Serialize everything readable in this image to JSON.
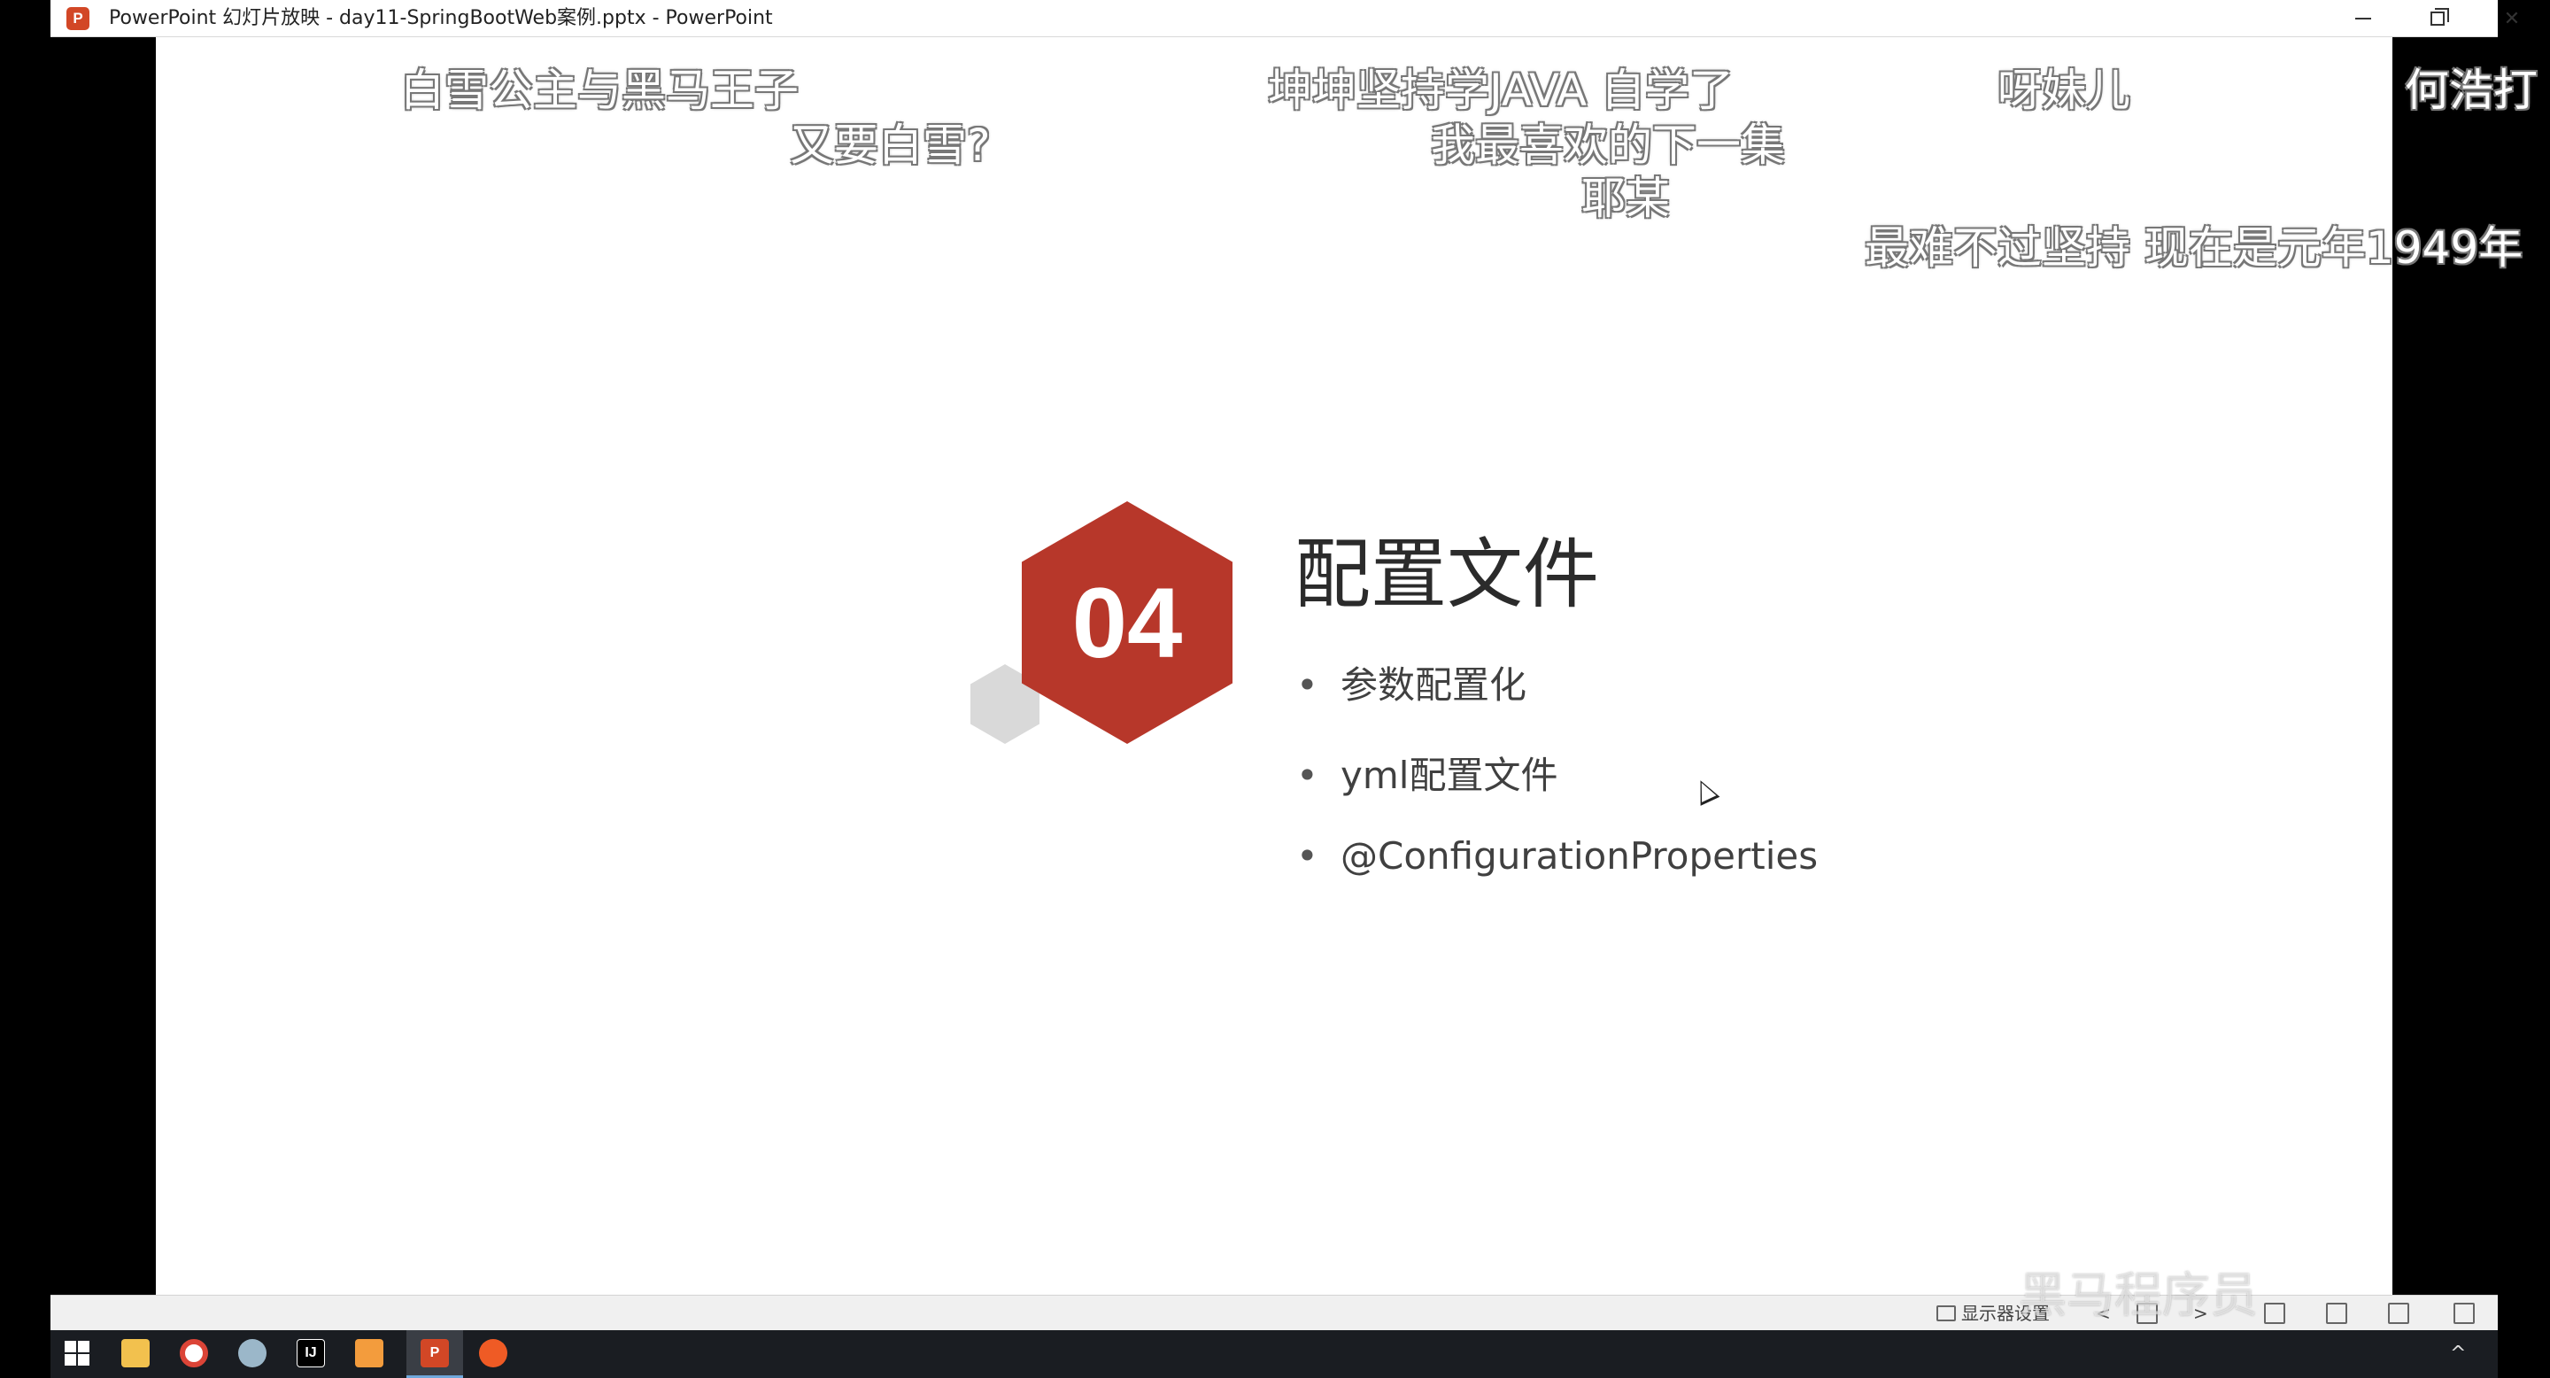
{
  "window": {
    "title": "PowerPoint 幻灯片放映  -  day11-SpringBootWeb案例.pptx - PowerPoint",
    "app_icon": "P",
    "controls": [
      "minimize",
      "restore",
      "close"
    ]
  },
  "danmaku": [
    "白雪公主与黑马王子",
    "又要白雪?",
    "坤坤坚持学JAVA  自学了",
    "我最喜欢的下一集",
    "耶某",
    "呀妹儿",
    "何浩打",
    "最难不过坚持 现在是元年1949年"
  ],
  "slide": {
    "section_number": "04",
    "title": "配置文件",
    "bullets": [
      "参数配置化",
      "yml配置文件",
      "@ConfigurationProperties"
    ],
    "bullet_symbol": "•",
    "accent_color": "#b7372a",
    "secondary_hex_color": "#d9d9d9"
  },
  "statusbar": {
    "display_settings": "显示器设置",
    "prev": "<",
    "next": ">"
  },
  "taskbar": {
    "icons": [
      "windows-start",
      "file-explorer",
      "chrome",
      "bird-app",
      "intellij-idea",
      "sublime",
      "powerpoint",
      "postman"
    ],
    "idea_label": "IJ",
    "ppt_label": "P",
    "tray_chevron": "^"
  },
  "watermark": "黑马程序员"
}
